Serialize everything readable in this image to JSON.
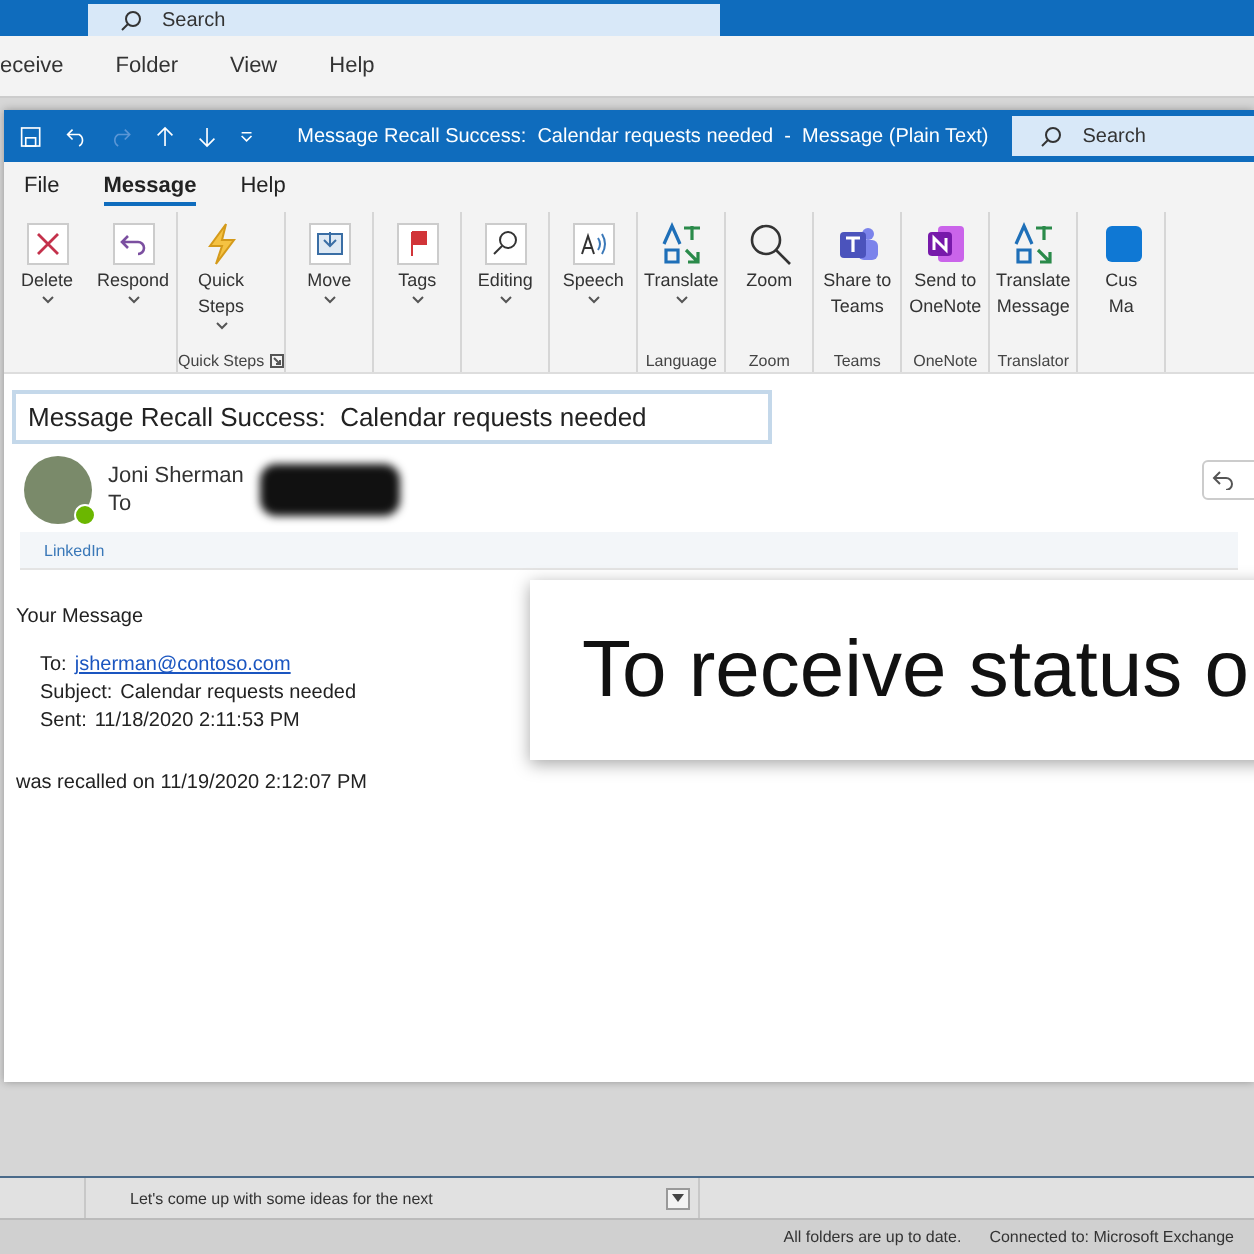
{
  "main_window": {
    "search": {
      "placeholder": "Search"
    },
    "menu": [
      "eceive",
      "Folder",
      "View",
      "Help"
    ]
  },
  "message_window": {
    "title": "Message Recall Success:  Calendar requests needed  -  Message (Plain Text)",
    "search": {
      "placeholder": "Search"
    },
    "tabs": [
      {
        "label": "File",
        "selected": false
      },
      {
        "label": "Message",
        "selected": true
      },
      {
        "label": "Help",
        "selected": false
      }
    ],
    "ribbon": [
      {
        "buttons": [
          {
            "kind": "delete",
            "lines": [
              "Delete"
            ],
            "caret": true
          },
          {
            "kind": "respond",
            "lines": [
              "Respond"
            ],
            "caret": true
          }
        ]
      },
      {
        "label": "Quick Steps",
        "launcher": true,
        "buttons": [
          {
            "kind": "quicksteps",
            "lines": [
              "Quick",
              "Steps"
            ],
            "caret": true
          }
        ]
      },
      {
        "buttons": [
          {
            "kind": "move",
            "lines": [
              "Move"
            ],
            "caret": true
          }
        ]
      },
      {
        "buttons": [
          {
            "kind": "tags",
            "lines": [
              "Tags"
            ],
            "caret": true
          }
        ]
      },
      {
        "buttons": [
          {
            "kind": "editing",
            "lines": [
              "Editing"
            ],
            "caret": true
          }
        ]
      },
      {
        "buttons": [
          {
            "kind": "speech",
            "lines": [
              "Speech"
            ],
            "caret": true
          }
        ]
      },
      {
        "label": "Language",
        "buttons": [
          {
            "kind": "translate",
            "lines": [
              "Translate"
            ],
            "caret": true
          }
        ]
      },
      {
        "label": "Zoom",
        "buttons": [
          {
            "kind": "zoom",
            "lines": [
              "Zoom"
            ],
            "caret": false
          }
        ]
      },
      {
        "label": "Teams",
        "buttons": [
          {
            "kind": "teams",
            "lines": [
              "Share to",
              "Teams"
            ],
            "caret": false
          }
        ]
      },
      {
        "label": "OneNote",
        "buttons": [
          {
            "kind": "onenote",
            "lines": [
              "Send to",
              "OneNote"
            ],
            "caret": false
          }
        ]
      },
      {
        "label": "Translator",
        "buttons": [
          {
            "kind": "translate",
            "lines": [
              "Translate",
              "Message"
            ],
            "caret": false
          }
        ]
      },
      {
        "buttons": [
          {
            "kind": "custom",
            "lines": [
              "Cus",
              "Ma"
            ],
            "caret": false
          }
        ]
      }
    ],
    "subject": "Message Recall Success:  Calendar requests needed",
    "sender": {
      "name": "Joni Sherman",
      "to_label": "To"
    },
    "linkedin": "LinkedIn",
    "body": {
      "heading": "Your Message",
      "fields": [
        {
          "label": "To:",
          "value": "jsherman@contoso.com",
          "kind": "link"
        },
        {
          "label": "Subject:",
          "value": "Calendar requests needed",
          "kind": "text"
        },
        {
          "label": "Sent:",
          "value": "11/18/2020 2:11:53 PM",
          "kind": "text"
        }
      ],
      "recalled": "was recalled on 11/19/2020 2:12:07 PM"
    }
  },
  "caption": "To receive status o",
  "preview": "Let's come up with some ideas for the next",
  "status_bar": [
    "All folders are up to date.",
    "Connected to: Microsoft Exchange"
  ]
}
